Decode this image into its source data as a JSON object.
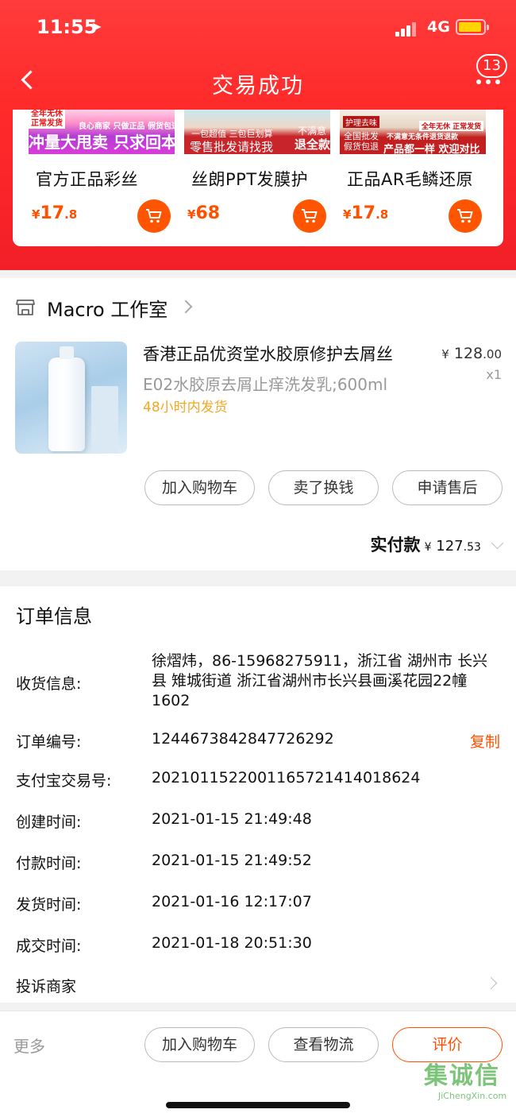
{
  "status_bar": {
    "time": "11:55",
    "network": "4G"
  },
  "nav": {
    "title": "交易成功",
    "badge": "13"
  },
  "recommendations": [
    {
      "image_tags": [
        "全年无休",
        "正常发货",
        "良心商家 只做正品 假货包退"
      ],
      "image_banner": "冲量大甩卖 只求回本",
      "name": "官方正品彩丝",
      "price_symbol": "¥",
      "price_int": "17",
      "price_dec": ".8"
    },
    {
      "image_tags": [
        "一包超值 三包巨划算",
        "不满意",
        "退全款"
      ],
      "image_banner": "零售批发请找我",
      "name": "丝朗PPT发膜护",
      "price_symbol": "¥",
      "price_int": "68",
      "price_dec": ""
    },
    {
      "image_tags": [
        "护理去味",
        "全年无休 正常发货",
        "不满意无条件退货退款"
      ],
      "image_banner": "产品都一样 欢迎对比",
      "image_side": "全国批发 假货包退",
      "name": "正品AR毛鳞还原",
      "price_symbol": "¥",
      "price_int": "17",
      "price_dec": ".8"
    }
  ],
  "shop": {
    "name": "Macro 工作室"
  },
  "product": {
    "title": "香港正品优资堂水胶原修护去屑丝",
    "sku": "E02水胶原去屑止痒洗发乳;600ml",
    "ship_note": "48小时内发货",
    "price_symbol": "¥",
    "price_int": "128",
    "price_dec": ".00",
    "quantity": "x1",
    "buttons": {
      "add_cart": "加入购物车",
      "resell": "卖了换钱",
      "after_sale": "申请售后"
    }
  },
  "payment": {
    "label": "实付款",
    "symbol": "¥",
    "int": "127",
    "dec": ".53"
  },
  "order_info": {
    "heading": "订单信息",
    "receiver_label": "收货信息:",
    "receiver_value": "徐熠炜，86-15968275911，浙江省 湖州市 长兴县 雉城街道 浙江省湖州市长兴县画溪花园22幢1602",
    "rows": [
      {
        "label": "订单编号:",
        "value": "1244673842847726292"
      },
      {
        "label": "支付宝交易号:",
        "value": "2021011522001165721414018624"
      },
      {
        "label": "创建时间:",
        "value": "2021-01-15 21:49:48"
      },
      {
        "label": "付款时间:",
        "value": "2021-01-15 21:49:52"
      },
      {
        "label": "发货时间:",
        "value": "2021-01-16 12:17:07"
      },
      {
        "label": "成交时间:",
        "value": "2021-01-18 20:51:30"
      }
    ],
    "copy_label": "复制",
    "complaint_label": "投诉商家"
  },
  "bottom_bar": {
    "more": "更多",
    "add_cart": "加入购物车",
    "logistics": "查看物流",
    "review": "评价"
  },
  "watermark": {
    "cn": "集诚信",
    "en": "JiChengXin.com"
  },
  "colors": {
    "header_red": "#ff2a2a",
    "accent_orange": "#ff5000",
    "ship_yellow": "#f5a623"
  }
}
